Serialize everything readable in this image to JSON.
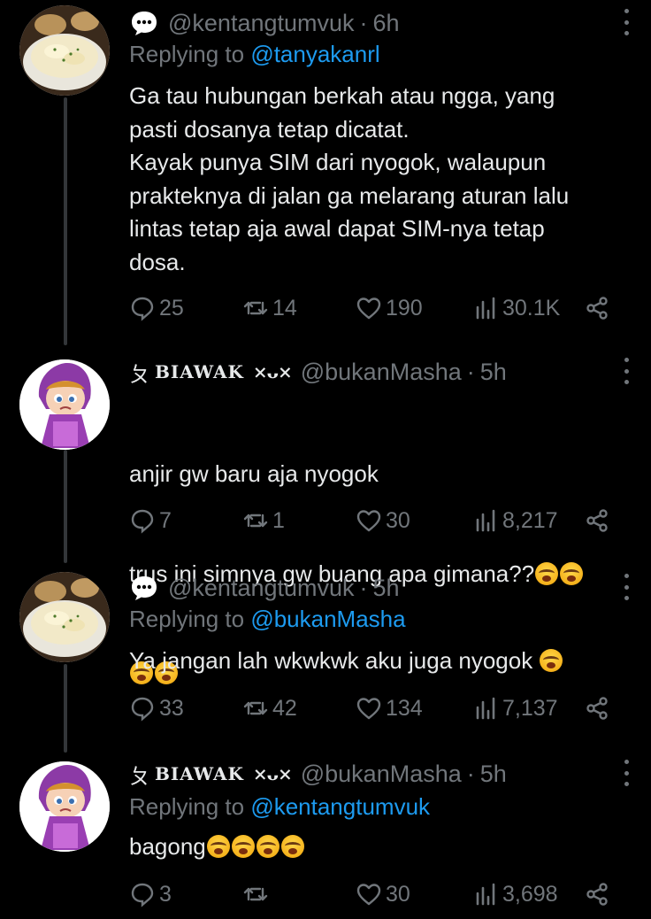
{
  "tweets": [
    {
      "handle": "@kentangtumvuk",
      "time": "6h",
      "replying_prefix": "Replying to ",
      "replying_to": "@tanyakanrl",
      "text": "Ga tau hubungan berkah atau ngga, yang\npasti dosanya tetap dicatat.\nKayak punya SIM dari nyogok, walaupun\nprakteknya di jalan ga melarang aturan lalu\nlintas tetap aja awal dapat SIM-nya tetap\ndosa.",
      "replies": "25",
      "reposts": "14",
      "likes": "190",
      "views": "30.1K"
    },
    {
      "name": "BIAWAK",
      "name_prefix": "ㄆ",
      "name_suffix": "×ᴗ×",
      "handle": "@bukanMasha",
      "time": "5h",
      "text_line1": "anjir gw baru aja nyogok",
      "text_line2": "trus ini simnya gw buang apa gimana??",
      "replies": "7",
      "reposts": "1",
      "likes": "30",
      "views": "8,217"
    },
    {
      "handle": "@kentangtumvuk",
      "time": "5h",
      "replying_prefix": "Replying to ",
      "replying_to": "@bukanMasha",
      "text": "Ya jangan lah wkwkwk aku juga nyogok",
      "replies": "33",
      "reposts": "42",
      "likes": "134",
      "views": "7,137"
    },
    {
      "name": "BIAWAK",
      "name_prefix": "ㄆ",
      "name_suffix": "×ᴗ×",
      "handle": "@bukanMasha",
      "time": "5h",
      "replying_prefix": "Replying to ",
      "replying_to": "@kentangtumvuk",
      "text": "bagong",
      "replies": "3",
      "reposts": "",
      "likes": "30",
      "views": "3,698"
    }
  ],
  "separator": "·",
  "icons": {
    "reply": "reply-icon",
    "repost": "repost-icon",
    "like": "heart-icon",
    "views": "views-icon",
    "share": "share-icon",
    "more": "more-icon",
    "bubble": "speech-bubble-icon",
    "emoji": "loudly-crying-face-emoji"
  },
  "colors": {
    "background": "#000000",
    "text": "#e7e9ea",
    "muted": "#71767b",
    "link": "#1d9bf0"
  }
}
